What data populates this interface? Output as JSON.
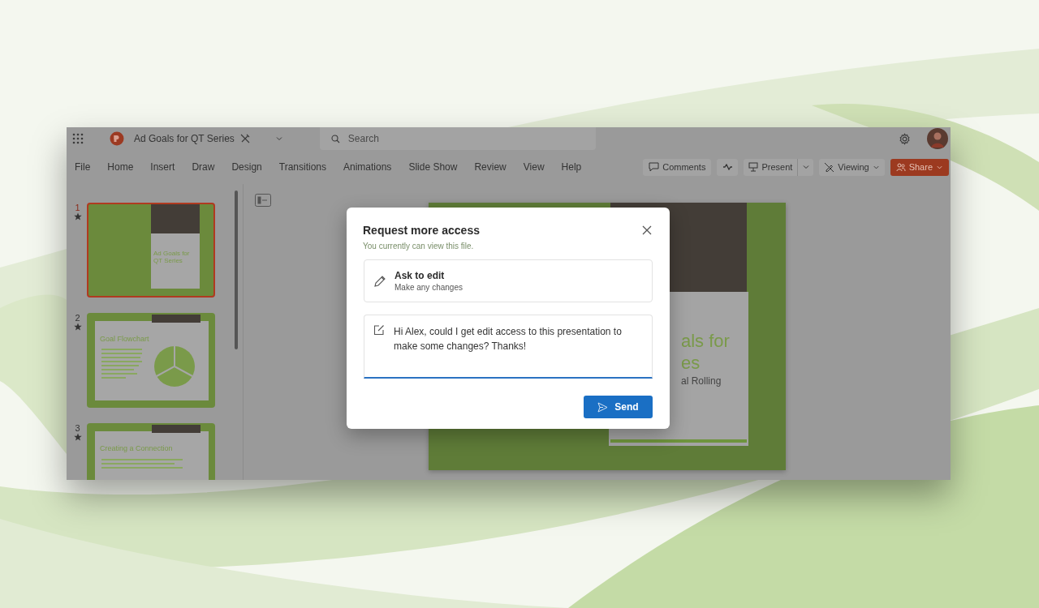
{
  "app_bar": {
    "document_title": "Ad Goals for QT Series",
    "search": {
      "placeholder": "Search"
    }
  },
  "ribbon_tabs": [
    "File",
    "Home",
    "Insert",
    "Draw",
    "Design",
    "Transitions",
    "Animations",
    "Slide Show",
    "Review",
    "View",
    "Help"
  ],
  "toolbar": {
    "comments": "Comments",
    "present": "Present",
    "viewing": "Viewing",
    "share": "Share"
  },
  "slides": [
    {
      "number": "1",
      "selected": true,
      "kind": "title",
      "title": "Ad Goals for QT Series"
    },
    {
      "number": "2",
      "selected": false,
      "kind": "chart",
      "title": "Goal Flowchart"
    },
    {
      "number": "3",
      "selected": false,
      "kind": "bullets",
      "title": "Creating a Connection"
    }
  ],
  "main_slide": {
    "title_lines": [
      "als for",
      "es"
    ],
    "subtitle": "al Rolling"
  },
  "dialog": {
    "title": "Request more access",
    "subtitle": "You currently can view this file.",
    "option": {
      "title": "Ask to edit",
      "description": "Make any changes"
    },
    "message": "Hi Alex, could I get edit access to this presentation to make some changes? Thanks!",
    "send": "Send"
  }
}
